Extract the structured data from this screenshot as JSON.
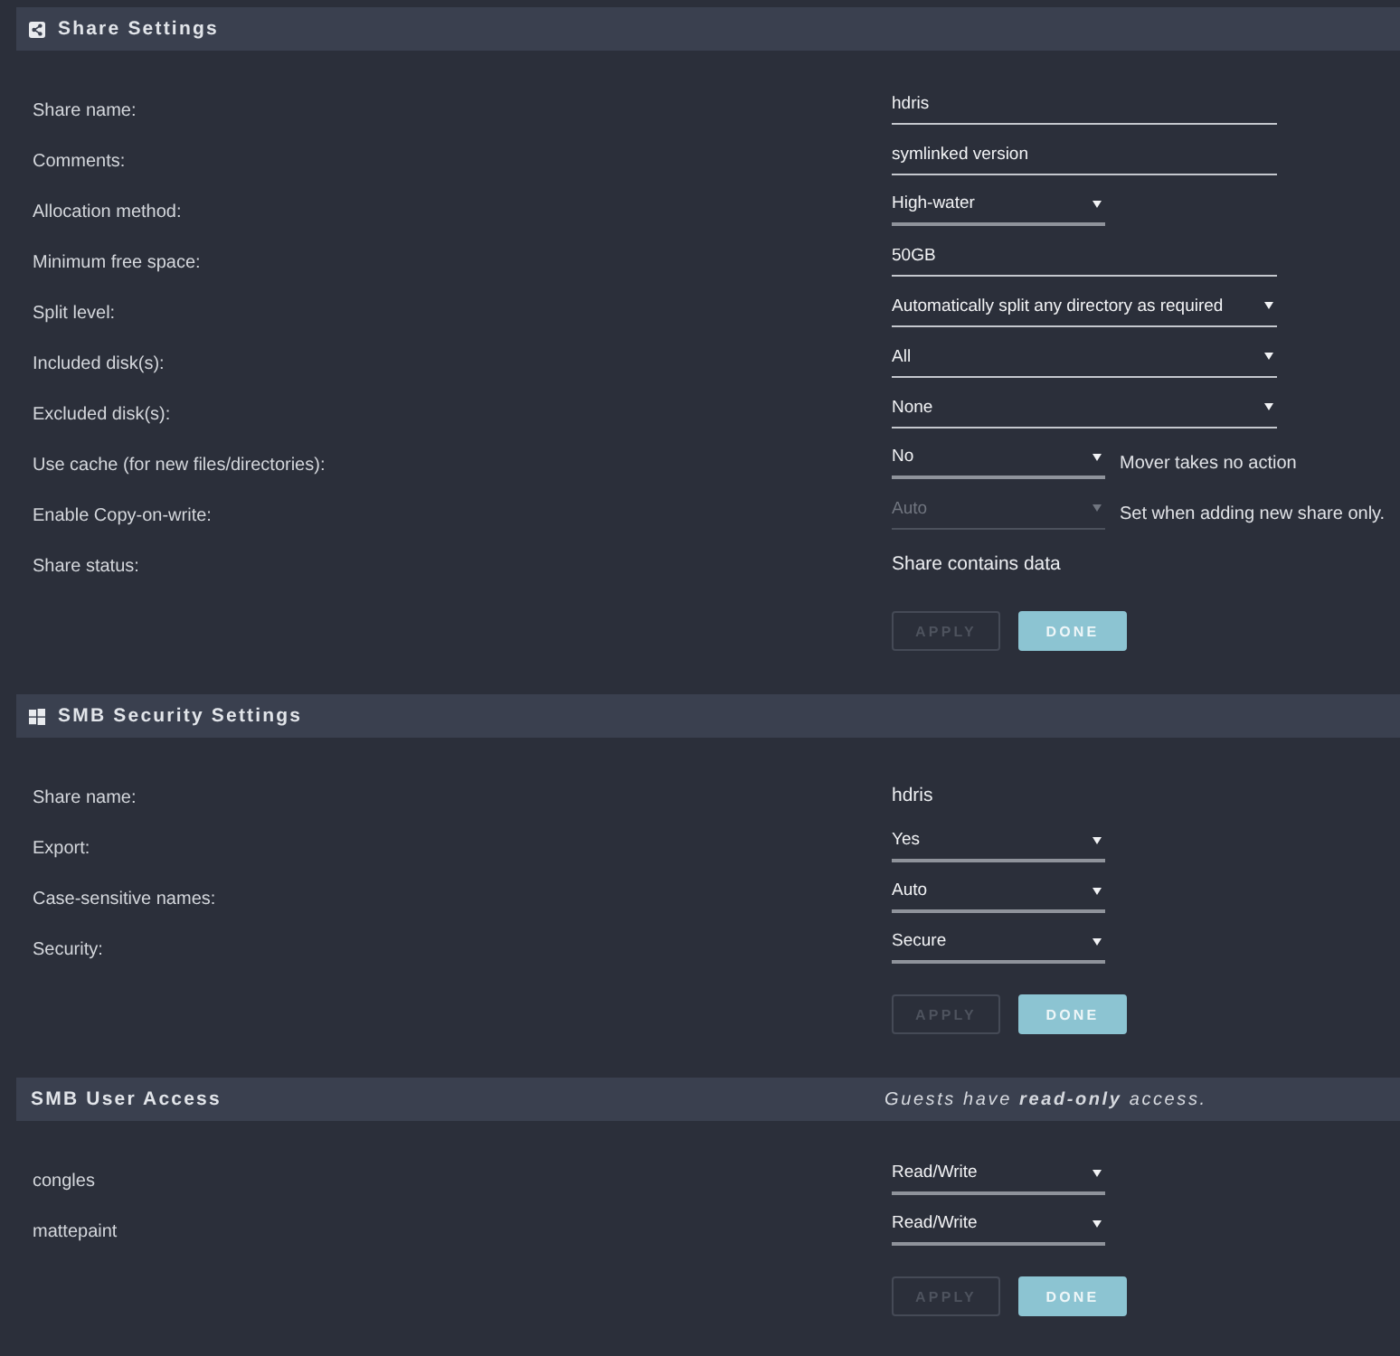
{
  "sections": [
    {
      "kind": "share",
      "title": "Share Settings",
      "fields": [
        {
          "kind": "text",
          "label": "Share name:",
          "value": "hdris",
          "disabled": false
        },
        {
          "kind": "text",
          "label": "Comments:",
          "value": "symlinked version",
          "disabled": false
        },
        {
          "kind": "select",
          "label": "Allocation method:",
          "value": "High-water",
          "disabled": false
        },
        {
          "kind": "text",
          "label": "Minimum free space:",
          "value": "50GB",
          "disabled": false
        },
        {
          "kind": "longselect",
          "label": "Split level:",
          "value": "Automatically split any directory as required",
          "disabled": false
        },
        {
          "kind": "longselect",
          "label": "Included disk(s):",
          "value": "All",
          "disabled": false
        },
        {
          "kind": "longselect",
          "label": "Excluded disk(s):",
          "value": "None",
          "disabled": false
        },
        {
          "kind": "select",
          "label": "Use cache (for new files/directories):",
          "value": "No",
          "disabled": false,
          "hint": "Mover takes no action"
        },
        {
          "kind": "select",
          "label": "Enable Copy-on-write:",
          "value": "Auto",
          "disabled": true,
          "hint": "Set when adding new share only."
        },
        {
          "kind": "status",
          "label": "Share status:",
          "value": "Share contains data",
          "disabled": false
        }
      ],
      "buttons": [
        {
          "label": "APPLY",
          "disabled": true
        },
        {
          "label": "DONE",
          "disabled": false
        }
      ]
    },
    {
      "kind": "smb",
      "title": "SMB Security Settings",
      "fields": [
        {
          "kind": "status",
          "label": "Share name:",
          "value": "hdris",
          "disabled": false
        },
        {
          "kind": "select",
          "label": "Export:",
          "value": "Yes",
          "disabled": false
        },
        {
          "kind": "select",
          "label": "Case-sensitive names:",
          "value": "Auto",
          "disabled": false
        },
        {
          "kind": "select",
          "label": "Security:",
          "value": "Secure",
          "disabled": false
        }
      ],
      "buttons": [
        {
          "label": "APPLY",
          "disabled": true
        },
        {
          "label": "DONE",
          "disabled": false
        }
      ]
    },
    {
      "kind": "access",
      "title": "SMB User Access",
      "note": "Guests have **read-only** access.",
      "fields": [
        {
          "kind": "select",
          "label": "congles",
          "value": "Read/Write",
          "disabled": false
        },
        {
          "kind": "select",
          "label": "mattepaint",
          "value": "Read/Write",
          "disabled": false
        }
      ],
      "buttons": [
        {
          "label": "APPLY",
          "disabled": true
        },
        {
          "label": "DONE",
          "disabled": false
        }
      ]
    }
  ]
}
